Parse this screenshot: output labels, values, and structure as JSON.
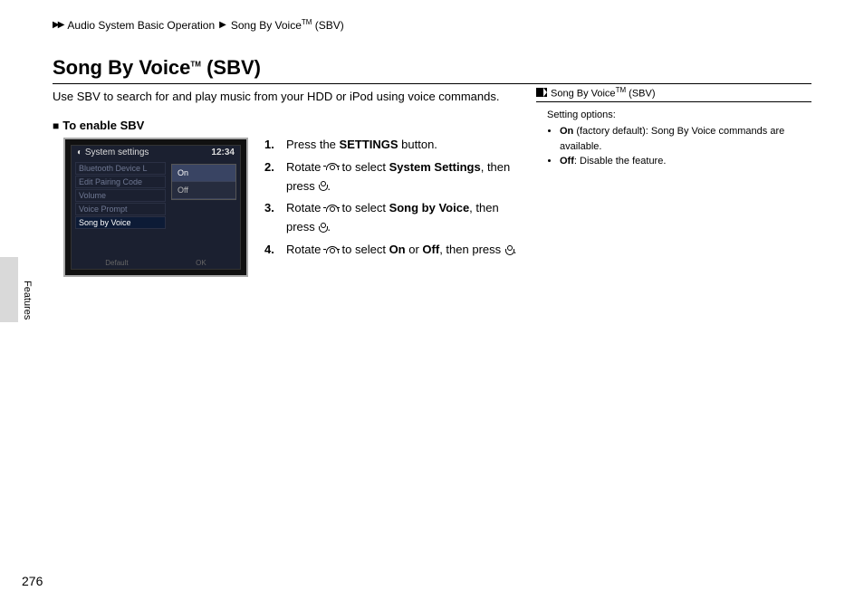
{
  "breadcrumb": {
    "seg1": "Audio System Basic Operation",
    "seg2_a": "Song By Voice",
    "seg2_b": " (SBV)"
  },
  "title": {
    "a": "Song By Voice",
    "b": " (SBV)"
  },
  "intro": "Use SBV to search for and play music from your HDD or iPod using voice commands.",
  "subhead": "To enable SBV",
  "screenshot": {
    "header": "System settings",
    "clock": "12:34",
    "rows": [
      "Bluetooth Device L",
      "Edit Pairing Code",
      "Volume",
      "Voice Prompt",
      "Song by Voice"
    ],
    "options": [
      "On",
      "Off"
    ],
    "footer_l": "Default",
    "footer_r": "OK"
  },
  "steps": {
    "s1a": "Press the ",
    "s1b": "SETTINGS",
    "s1c": " button.",
    "s2a": "Rotate ",
    "s2b": " to select ",
    "s2c": "System Settings",
    "s2d": ", then press ",
    "s2e": ".",
    "s3a": "Rotate ",
    "s3b": " to select ",
    "s3c": "Song by Voice",
    "s3d": ", then press ",
    "s3e": ".",
    "s4a": "Rotate ",
    "s4b": " to select ",
    "s4c": "On",
    "s4d": " or ",
    "s4e": "Off",
    "s4f": ", then press ",
    "s4g": "."
  },
  "sidebar": {
    "head_a": "Song By Voice",
    "head_b": " (SBV)",
    "intro": "Setting options:",
    "item1a": "On",
    "item1b": " (factory default): Song By Voice commands are available.",
    "item2a": "Off",
    "item2b": ": Disable the feature."
  },
  "tab": "Features",
  "page": "276"
}
